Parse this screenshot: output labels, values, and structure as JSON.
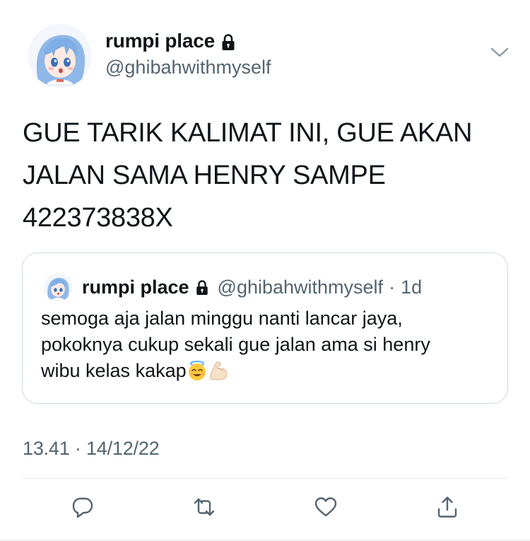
{
  "tweet": {
    "author": {
      "display_name": "rumpi place",
      "handle": "@ghibahwithmyself",
      "avatar_icon": "anime-girl-avatar",
      "protected_icon": "lock-icon"
    },
    "text": "GUE TARIK KALIMAT INI, GUE AKAN\nJALAN SAMA HENRY SAMPE\n422373838X",
    "timestamp": "13.41 · 14/12/22"
  },
  "quote": {
    "display_name": "rumpi place",
    "handle": "@ghibahwithmyself",
    "separator": "·",
    "time": "1d",
    "text_lines": [
      "semoga aja jalan minggu nanti lancar jaya,",
      "pokoknya cukup sekali gue jalan ama si henry",
      "wibu kelas kakap"
    ],
    "emojis": [
      "smiling-face-with-halo-emoji",
      "flexed-biceps-emoji"
    ]
  },
  "actions": [
    {
      "name": "reply",
      "icon": "reply-icon"
    },
    {
      "name": "retweet",
      "icon": "retweet-icon"
    },
    {
      "name": "like",
      "icon": "heart-icon"
    },
    {
      "name": "share",
      "icon": "share-icon"
    }
  ],
  "colors": {
    "text_primary": "#0f1419",
    "text_secondary": "#536471",
    "border": "#cfd9de",
    "icon": "#536471"
  }
}
